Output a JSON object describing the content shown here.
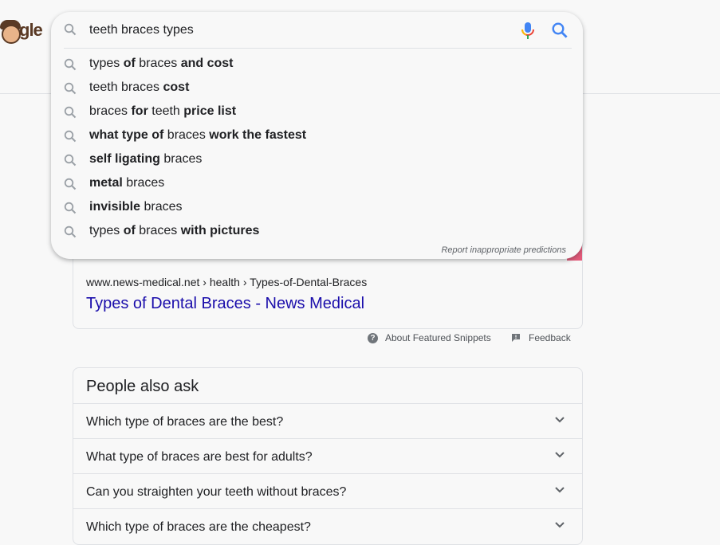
{
  "logo": {
    "text": "gle"
  },
  "search": {
    "query": "teeth braces types",
    "placeholder": ""
  },
  "suggestions": [
    [
      {
        "t": "types ",
        "b": false
      },
      {
        "t": "of",
        "b": true
      },
      {
        "t": " braces ",
        "b": false
      },
      {
        "t": "and cost",
        "b": true
      }
    ],
    [
      {
        "t": "teeth braces ",
        "b": false
      },
      {
        "t": "cost",
        "b": true
      }
    ],
    [
      {
        "t": "braces ",
        "b": false
      },
      {
        "t": "for",
        "b": true
      },
      {
        "t": " teeth ",
        "b": false
      },
      {
        "t": "price list",
        "b": true
      }
    ],
    [
      {
        "t": "what type of",
        "b": true
      },
      {
        "t": " braces ",
        "b": false
      },
      {
        "t": "work the fastest",
        "b": true
      }
    ],
    [
      {
        "t": "self ligating",
        "b": true
      },
      {
        "t": " braces",
        "b": false
      }
    ],
    [
      {
        "t": "metal",
        "b": true
      },
      {
        "t": " braces",
        "b": false
      }
    ],
    [
      {
        "t": "invisible",
        "b": true
      },
      {
        "t": " braces",
        "b": false
      }
    ],
    [
      {
        "t": "types ",
        "b": false
      },
      {
        "t": "of",
        "b": true
      },
      {
        "t": " braces ",
        "b": false
      },
      {
        "t": "with pictures",
        "b": true
      }
    ]
  ],
  "report_label": "Report inappropriate predictions",
  "result": {
    "cite": "www.news-medical.net › health › Types-of-Dental-Braces",
    "title": "Types of Dental Braces - News Medical"
  },
  "snippet_footer": {
    "about": "About Featured Snippets",
    "feedback": "Feedback"
  },
  "paa": {
    "title": "People also ask",
    "questions": [
      "Which type of braces are the best?",
      "What type of braces are best for adults?",
      "Can you straighten your teeth without braces?",
      "Which type of braces are the cheapest?"
    ]
  },
  "colors": {
    "link": "#1a0dab",
    "icon_gray": "#9aa0a6",
    "mic_blue": "#4285f4",
    "mic_red": "#ea4335",
    "mic_yellow": "#fbbc04",
    "mic_green": "#34a853"
  }
}
